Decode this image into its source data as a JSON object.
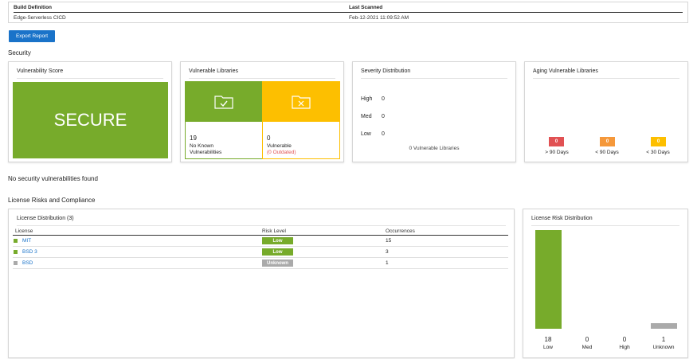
{
  "build": {
    "definition_header": "Build Definition",
    "definition_value": "Edge-Serverless CICD",
    "scanned_header": "Last Scanned",
    "scanned_value": "Feb-12-2021 11:09:52 AM"
  },
  "toolbar": {
    "export_label": "Export Report"
  },
  "security": {
    "section_title": "Security",
    "score": {
      "title": "Vulnerability Score",
      "value": "SECURE",
      "color": "#77ab2b"
    },
    "libraries": {
      "title": "Vulnerable Libraries",
      "secure_count": "19",
      "secure_label_1": "No Known",
      "secure_label_2": "Vulnerabilities",
      "vulnerable_count": "0",
      "vulnerable_label": "Vulnerable",
      "outdated_label": "(0 Outdated)",
      "secure_color": "#77ab2b",
      "vulnerable_color": "#fdbf00",
      "secure_icon": "folder-check-icon",
      "vulnerable_icon": "folder-x-icon"
    },
    "severity": {
      "title": "Severity Distribution",
      "rows": [
        {
          "label": "High",
          "value": "0"
        },
        {
          "label": "Med",
          "value": "0"
        },
        {
          "label": "Low",
          "value": "0"
        }
      ],
      "footer": "0 Vulnerable Libraries"
    },
    "aging": {
      "title": "Aging Vulnerable Libraries",
      "items": [
        {
          "value": "0",
          "label": "> 90 Days",
          "color": "#e15153"
        },
        {
          "value": "0",
          "label": "< 90 Days",
          "color": "#f5983a"
        },
        {
          "value": "0",
          "label": "< 30 Days",
          "color": "#fdbf00"
        }
      ]
    },
    "status_message": "No security vulnerabilities found"
  },
  "license": {
    "section_title": "License Risks and Compliance",
    "distribution": {
      "title": "License Distribution (3)",
      "columns": [
        "License",
        "Risk Level",
        "Occurrences"
      ],
      "rows": [
        {
          "name": "MIT",
          "risk": "Low",
          "occurrences": "15",
          "color": "#77ab2b"
        },
        {
          "name": "BSD 3",
          "risk": "Low",
          "occurrences": "3",
          "color": "#77ab2b"
        },
        {
          "name": "BSD",
          "risk": "Unknown",
          "occurrences": "1",
          "color": "#aaaaaa"
        }
      ]
    },
    "risk_chart": {
      "title": "License Risk Distribution"
    }
  },
  "chart_data": {
    "type": "bar",
    "title": "License Risk Distribution",
    "categories": [
      "Low",
      "Med",
      "High",
      "Unknown"
    ],
    "values": [
      18,
      0,
      0,
      1
    ],
    "colors": [
      "#77ab2b",
      "#77ab2b",
      "#77ab2b",
      "#aaaaaa"
    ],
    "ylim": [
      0,
      18
    ]
  }
}
